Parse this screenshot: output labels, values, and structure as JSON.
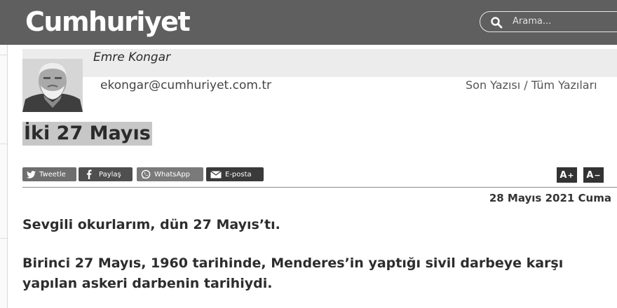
{
  "header": {
    "logo_text": "Cumhuriyet",
    "search_placeholder": "Arama..."
  },
  "author": {
    "name": "Emre Kongar",
    "email": "ekongar@cumhuriyet.com.tr",
    "last_article_label": "Son Yazısı",
    "separator": " / ",
    "all_articles_label": "Tüm Yazıları"
  },
  "article": {
    "title": "İki 27 Mayıs",
    "date": "28 Mayıs 2021 Cuma",
    "paragraphs": [
      "Sevgili okurlarım, dün 27 Mayıs’tı.",
      "Birinci 27 Mayıs, 1960 tarihinde, Menderes’in yaptığı sivil darbeye karşı yapılan askeri darbenin tarihiydi."
    ]
  },
  "share": {
    "tweet_label": "Tweetle",
    "facebook_label": "Paylaş",
    "whatsapp_label": "WhatsApp",
    "email_label": "E-posta"
  },
  "font_controls": {
    "increase_label": "A",
    "increase_mark": "+",
    "decrease_label": "A",
    "decrease_mark": "−"
  },
  "colors": {
    "header_bg": "#5f5f5f",
    "title_highlight": "#c7c7c7"
  }
}
